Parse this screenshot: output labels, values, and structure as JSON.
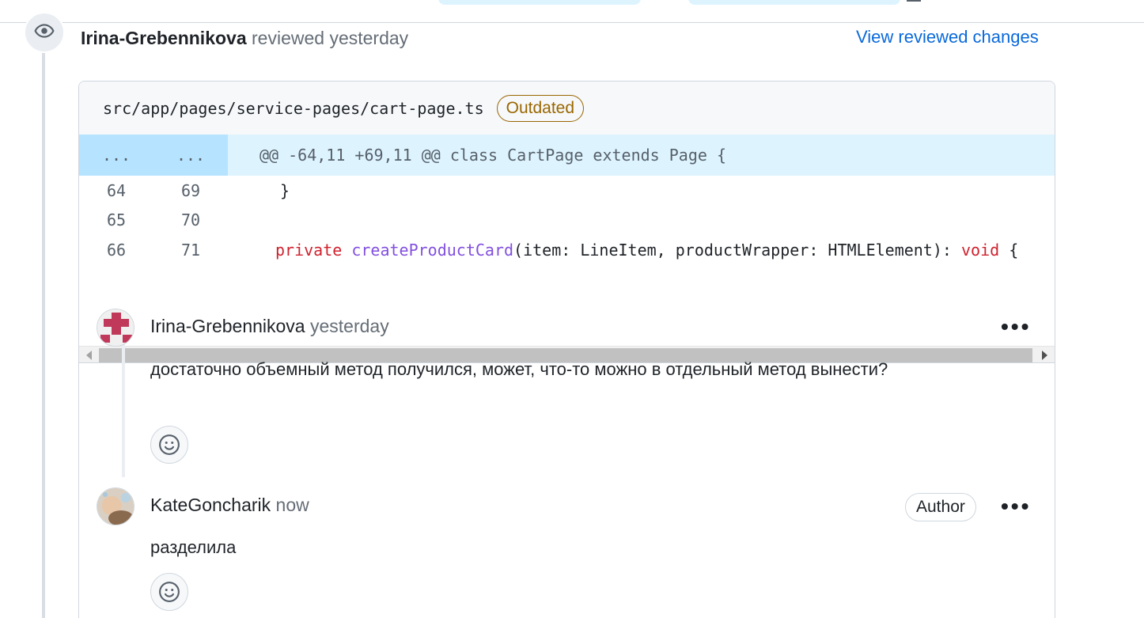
{
  "review": {
    "author": "Irina-Grebennikova",
    "action": "reviewed yesterday",
    "view_changes_label": "View reviewed changes"
  },
  "file": {
    "path": "src/app/pages/service-pages/cart-page.ts",
    "badge": "Outdated"
  },
  "diff": {
    "hunk_old": "...",
    "hunk_new": "...",
    "hunk_header": "@@ -64,11 +69,11 @@ class CartPage extends Page {",
    "lines": [
      {
        "old": "64",
        "new": "69",
        "code": "}"
      },
      {
        "old": "65",
        "new": "70",
        "code": ""
      },
      {
        "old": "66",
        "new": "71",
        "kw1": "private",
        "fn": "createProductCard",
        "mid": "(item: LineItem, productWrapper: HTMLElement): ",
        "kw2": "void",
        "end": " {"
      }
    ]
  },
  "comments": [
    {
      "author": "Irina-Grebennikova",
      "time": "yesterday",
      "body": "достаточно объемный метод получился, может, что-то можно в отдельный метод вынести?",
      "menu": "•••"
    },
    {
      "author": "KateGoncharik",
      "time": "now",
      "badge": "Author",
      "body": "разделила",
      "menu": "•••"
    }
  ],
  "icons": {
    "review": "eye-icon",
    "reaction": "smiley-icon",
    "menu": "kebab-horizontal-icon"
  },
  "colors": {
    "link": "#0969da",
    "outdated": "#9a6700",
    "hunk_bg": "#ddf4ff",
    "keyword": "#cf222e",
    "function": "#8250df"
  }
}
